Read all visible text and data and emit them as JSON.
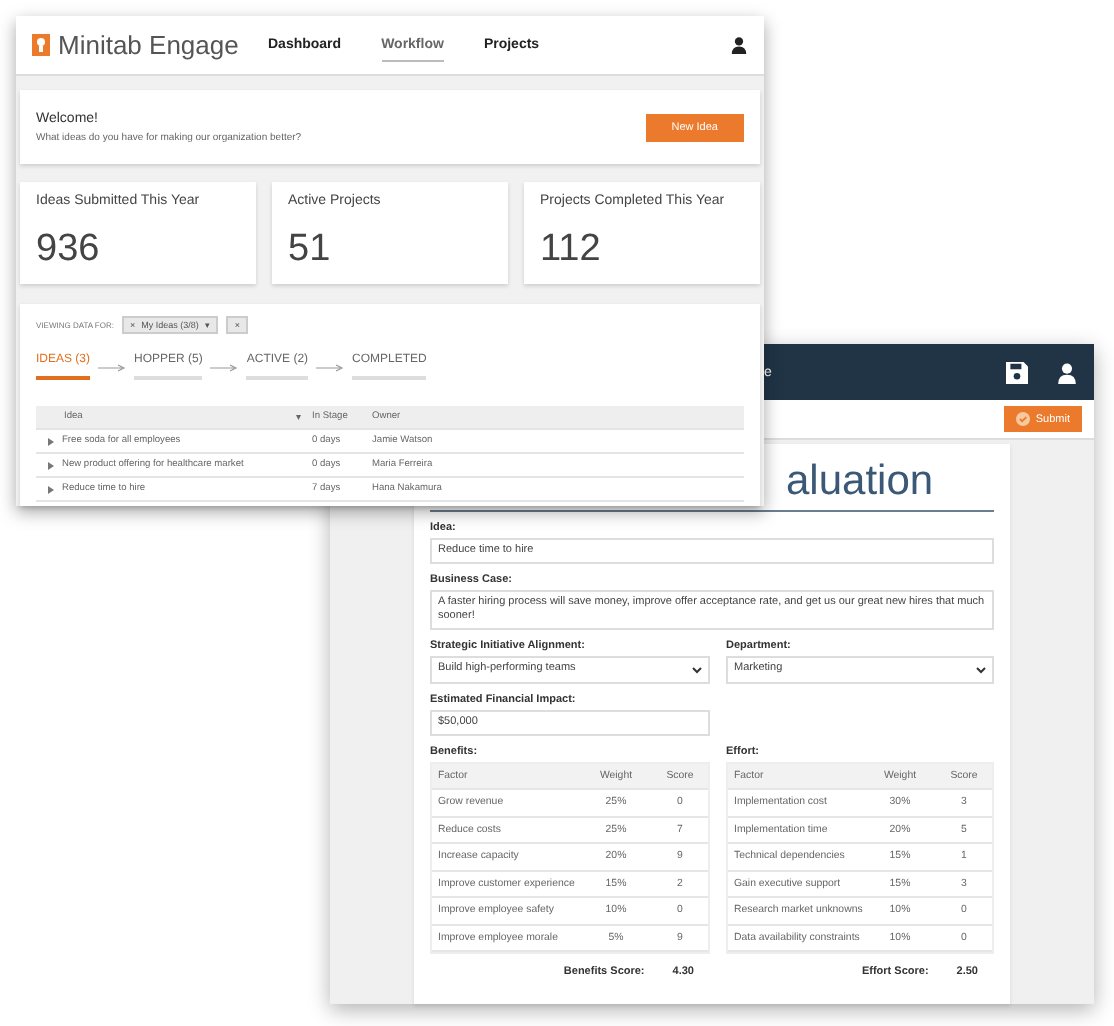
{
  "dashboard_window": {
    "app_name": "Minitab Engage",
    "nav": [
      {
        "label": "Dashboard",
        "selected": false
      },
      {
        "label": "Workflow",
        "selected": true
      },
      {
        "label": "Projects",
        "selected": false
      }
    ],
    "welcome": {
      "title": "Welcome!",
      "message": "What ideas do you have for making our organization better?",
      "button": "New Idea"
    },
    "stats": [
      {
        "label": "Ideas Submitted This Year",
        "value": "936"
      },
      {
        "label": "Active Projects",
        "value": "51"
      },
      {
        "label": "Projects Completed This Year",
        "value": "112"
      }
    ],
    "filter": {
      "label": "VIEWING DATA FOR:",
      "chip_remove": "×",
      "value": "My Ideas (3/8)",
      "caret": "▾",
      "clear": "×"
    },
    "pipeline": [
      {
        "label": "IDEAS (3)",
        "selected": true
      },
      {
        "label": "HOPPER (5)",
        "selected": false
      },
      {
        "label": "ACTIVE (2)",
        "selected": false
      },
      {
        "label": "COMPLETED",
        "selected": false
      }
    ],
    "table": {
      "columns": [
        "Idea",
        "In Stage",
        "Owner"
      ],
      "sort_mark": "▾",
      "rows": [
        {
          "idea": "Free soda for all employees",
          "in_stage": "0 days",
          "owner": "Jamie Watson"
        },
        {
          "idea": "New product offering for healthcare market",
          "in_stage": "0 days",
          "owner": "Maria Ferreira"
        },
        {
          "idea": "Reduce time to hire",
          "in_stage": "7 days",
          "owner": "Hana Nakamura"
        }
      ]
    }
  },
  "evaluation_window": {
    "header_title": "e",
    "submit": "Submit",
    "form_title": "aluation",
    "idea": {
      "label": "Idea:",
      "value": "Reduce time to hire"
    },
    "business_case": {
      "label": "Business Case:",
      "value": "A faster hiring process will save money, improve offer acceptance rate, and get us our great new hires that much sooner!"
    },
    "alignment": {
      "label": "Strategic Initiative Alignment:",
      "value": "Build high-performing teams"
    },
    "department": {
      "label": "Department:",
      "value": "Marketing"
    },
    "impact": {
      "label": "Estimated Financial Impact:",
      "value": "$50,000"
    },
    "tables": [
      {
        "label": "Benefits:",
        "columns": [
          "Factor",
          "Weight",
          "Score"
        ],
        "rows": [
          [
            "Grow revenue",
            "25%",
            "0"
          ],
          [
            "Reduce costs",
            "25%",
            "7"
          ],
          [
            "Increase capacity",
            "20%",
            "9"
          ],
          [
            "Improve customer experience",
            "15%",
            "2"
          ],
          [
            "Improve employee safety",
            "10%",
            "0"
          ],
          [
            "Improve employee morale",
            "5%",
            "9"
          ]
        ],
        "score_label": "Benefits Score:",
        "score": "4.30"
      },
      {
        "label": "Effort:",
        "columns": [
          "Factor",
          "Weight",
          "Score"
        ],
        "rows": [
          [
            "Implementation cost",
            "30%",
            "3"
          ],
          [
            "Implementation time",
            "20%",
            "5"
          ],
          [
            "Technical dependencies",
            "15%",
            "1"
          ],
          [
            "Gain executive support",
            "15%",
            "3"
          ],
          [
            "Research market unknowns",
            "10%",
            "0"
          ],
          [
            "Data availability constraints",
            "10%",
            "0"
          ]
        ],
        "score_label": "Effort Score:",
        "score": "2.50"
      }
    ]
  }
}
